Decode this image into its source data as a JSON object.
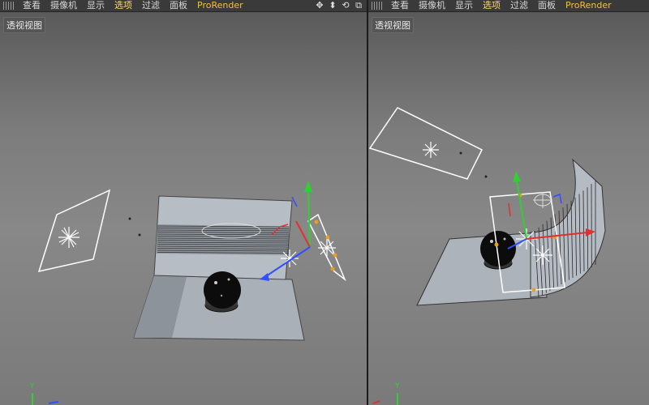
{
  "left_view": {
    "menu": [
      "查看",
      "摄像机",
      "显示",
      "选项",
      "过滤",
      "面板",
      "ProRender"
    ],
    "active_menu": "选项",
    "view_label": "透视视图",
    "nav_icons": [
      "move-view-icon",
      "dolly-view-icon",
      "rotate-view-icon",
      "toggle-layout-icon"
    ]
  },
  "right_view": {
    "menu": [
      "查看",
      "摄像机",
      "显示",
      "选项",
      "过滤",
      "面板",
      "ProRender"
    ],
    "active_menu": "选项",
    "view_label": "透视视图"
  },
  "axis_label": "Y",
  "colors": {
    "active_menu": "#ffd86b",
    "brand": "#f0c040",
    "axis_x": "#e03030",
    "axis_y": "#30d030",
    "axis_z": "#3050ff"
  }
}
